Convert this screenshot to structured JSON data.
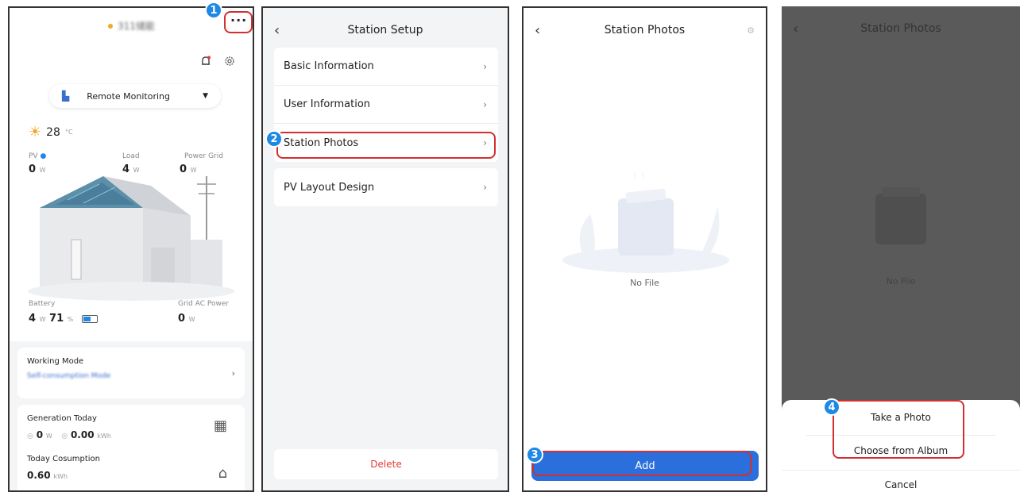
{
  "panel1": {
    "site_name": "311储能",
    "more_icon": "···",
    "mode_label": "Remote Monitoring",
    "temperature": "28",
    "temperature_unit": "°C",
    "pv_label": "PV",
    "pv_value": "0",
    "pv_unit": "W",
    "load_label": "Load",
    "load_value": "4",
    "load_unit": "W",
    "grid_label": "Power Grid",
    "grid_value": "0",
    "grid_unit": "W",
    "battery_label": "Battery",
    "battery_power": "4",
    "battery_power_unit": "W",
    "battery_soc": "71",
    "battery_soc_unit": "%",
    "grid_ac_label": "Grid AC Power",
    "grid_ac_value": "0",
    "grid_ac_unit": "W",
    "working_mode_title": "Working Mode",
    "working_mode_value": "Self-consumption Mode",
    "generation_title": "Generation Today",
    "generation_power": "0",
    "generation_power_unit": "W",
    "generation_energy": "0.00",
    "generation_energy_unit": "kWh",
    "consumption_title": "Today Cosumption",
    "consumption_value": "0.60",
    "consumption_unit": "kWh"
  },
  "panel2": {
    "title": "Station Setup",
    "items": [
      {
        "label": "Basic Information"
      },
      {
        "label": "User Information"
      },
      {
        "label": "Station Photos"
      },
      {
        "label": "PV Layout Design"
      }
    ],
    "delete_label": "Delete"
  },
  "panel3": {
    "title": "Station Photos",
    "empty_text": "No File",
    "add_label": "Add"
  },
  "panel4": {
    "title": "Station Photos",
    "empty_text": "No File",
    "sheet": {
      "take_photo": "Take a Photo",
      "choose_album": "Choose from Album",
      "cancel": "Cancel"
    }
  },
  "callouts": [
    "1",
    "2",
    "3",
    "4"
  ],
  "colors": {
    "accent": "#1e88e5",
    "highlight": "#d32f2f",
    "primary_button": "#2a6fdb",
    "danger": "#e53935",
    "overlay": "#5a5a5a"
  }
}
